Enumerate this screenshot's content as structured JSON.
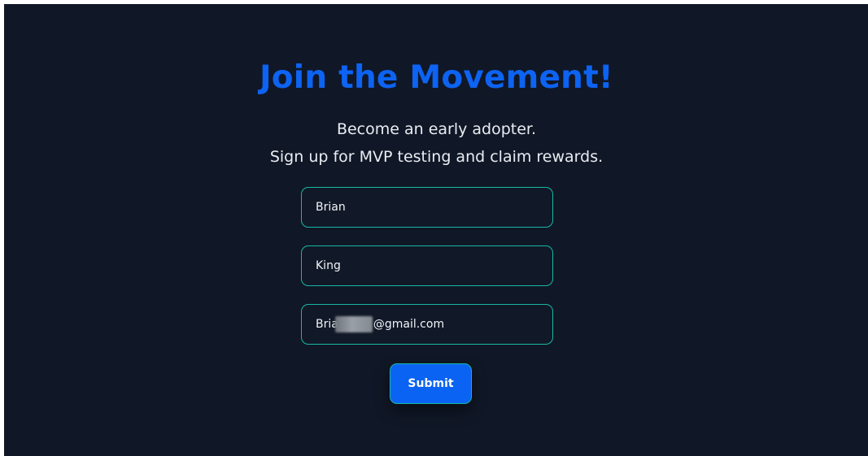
{
  "header": {
    "title": "Join the Movement!",
    "subtitle_line1": "Become an early adopter.",
    "subtitle_line2": "Sign up for MVP testing and claim rewards."
  },
  "form": {
    "first_name_value": "Brian",
    "last_name_value": "King",
    "email_prefix": "Bria",
    "email_suffix": "@gmail.com",
    "submit_label": "Submit"
  },
  "colors": {
    "background": "#101726",
    "title_accent": "#0d63f2",
    "field_border": "#17b8a6",
    "button": "#0a63f2"
  }
}
